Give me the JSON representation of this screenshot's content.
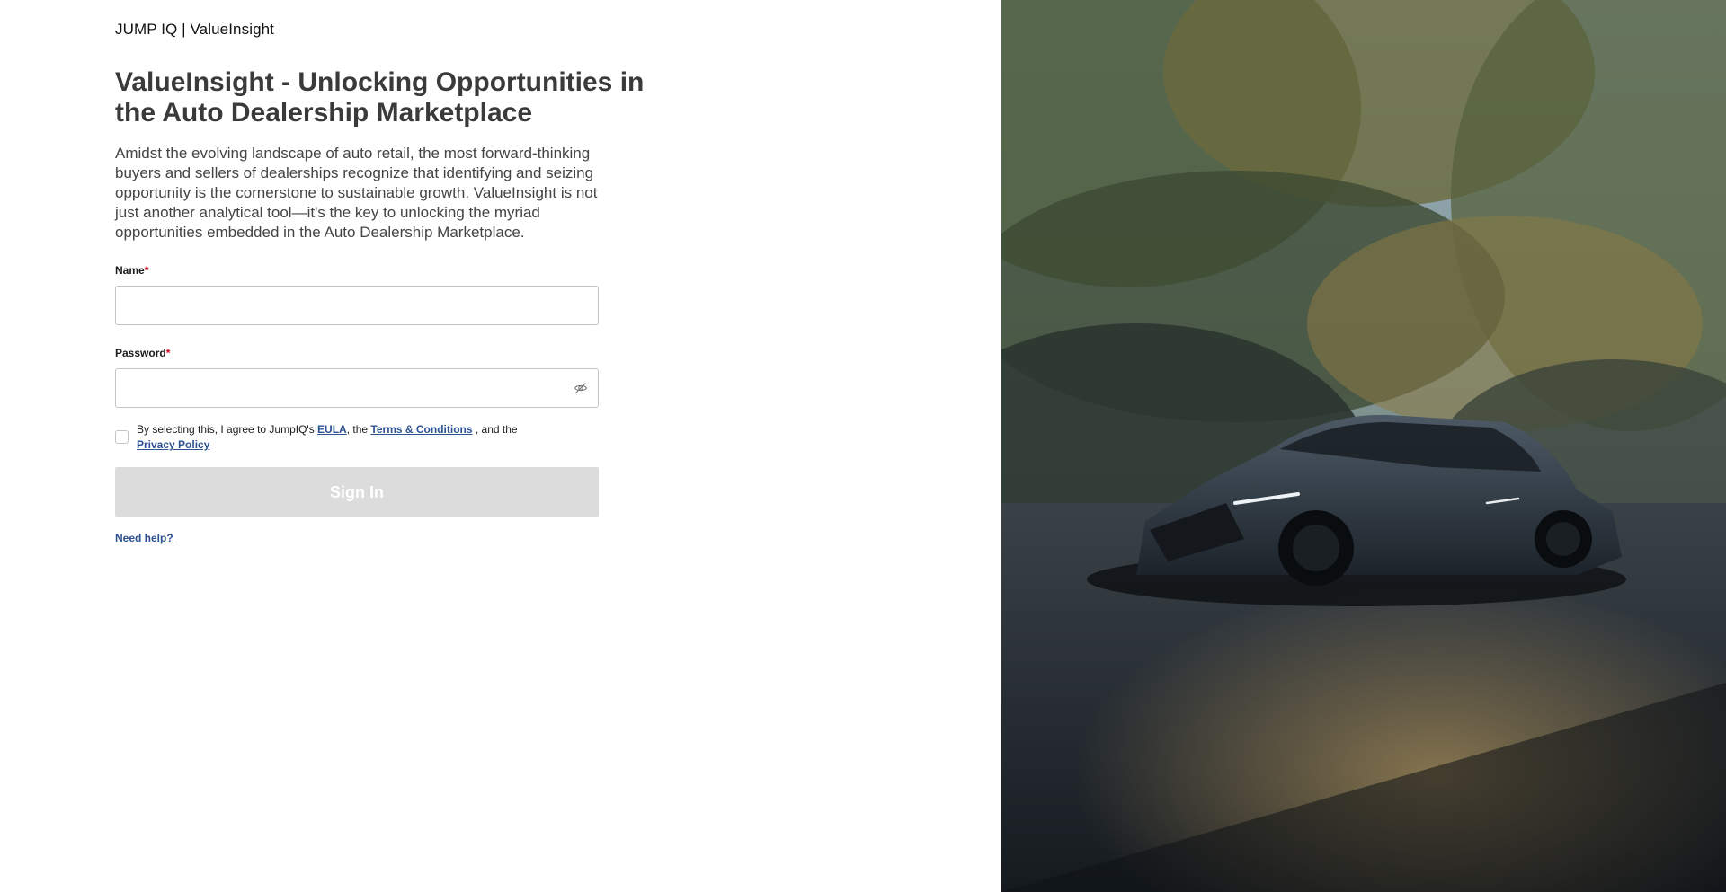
{
  "brand": {
    "title": "JUMP IQ | ValueInsight"
  },
  "main": {
    "heading": "ValueInsight - Unlocking Opportunities in the Auto Dealership Marketplace",
    "description": "Amidst the evolving landscape of auto retail, the most forward-thinking buyers and sellers of dealerships recognize that identifying and seizing opportunity is the cornerstone to sustainable growth. ValueInsight is not just another analytical tool—it's the key to unlocking the myriad opportunities embedded in the Auto Dealership Marketplace."
  },
  "form": {
    "name_label": "Name",
    "name_value": "",
    "password_label": "Password",
    "password_value": "",
    "required_mark": "*",
    "agree_prefix": "By selecting this, I agree to JumpIQ's ",
    "eula_link": "EULA",
    "agree_mid": ", the ",
    "terms_link": "Terms & Conditions",
    "agree_mid2": " , and the ",
    "privacy_link": "Privacy Policy",
    "agree_checked": false,
    "signin_label": "Sign In",
    "help_link": "Need help?"
  },
  "icons": {
    "password_toggle": "eye-slash-icon"
  },
  "colors": {
    "link": "#2d5291",
    "required": "#d0021b",
    "button_disabled": "#dcdcdc",
    "heading": "#3a3a3a"
  }
}
